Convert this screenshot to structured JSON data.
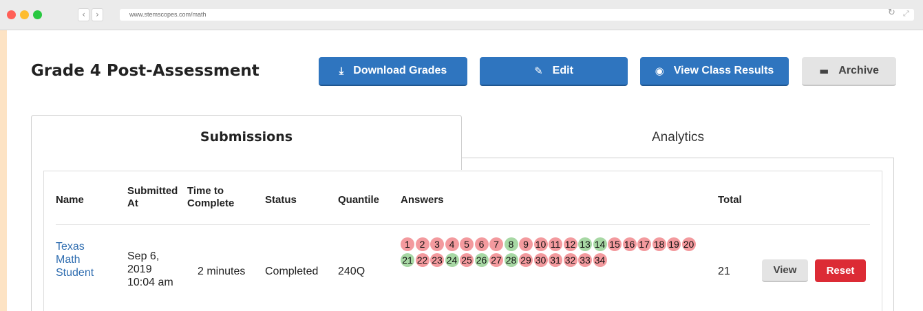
{
  "browser": {
    "url": "www.stemscopes.com/math",
    "back_icon": "‹",
    "forward_icon": "›",
    "reload_icon": "↻",
    "expand_icon": "⤢",
    "dots": [
      "#ff5f57",
      "#febc2e",
      "#28c840"
    ]
  },
  "header": {
    "title": "Grade 4 Post-Assessment",
    "buttons": {
      "download": {
        "label": "Download Grades",
        "icon": "⤓"
      },
      "edit": {
        "label": "Edit",
        "icon": "✎"
      },
      "view_results": {
        "label": "View Class Results",
        "icon": "◉"
      },
      "archive": {
        "label": "Archive",
        "icon": "▬"
      }
    }
  },
  "tabs": [
    {
      "label": "Submissions",
      "active": true
    },
    {
      "label": "Analytics",
      "active": false
    }
  ],
  "table": {
    "headers": {
      "name": "Name",
      "submitted_l1": "Submitted",
      "submitted_l2": "At",
      "time_l1": "Time to",
      "time_l2": "Complete",
      "status": "Status",
      "quantile": "Quantile",
      "answers": "Answers",
      "total": "Total"
    },
    "row": {
      "name_l1": "Texas",
      "name_l2": "Math",
      "name_l3": "Student",
      "submitted_l1": "Sep 6,",
      "submitted_l2": "2019",
      "submitted_l3": "10:04 am",
      "time": "2 minutes",
      "status": "Completed",
      "quantile": "240Q",
      "total": "21",
      "view_label": "View",
      "reset_label": "Reset",
      "answers": [
        {
          "n": "1",
          "correct": false
        },
        {
          "n": "2",
          "correct": false
        },
        {
          "n": "3",
          "correct": false
        },
        {
          "n": "4",
          "correct": false
        },
        {
          "n": "5",
          "correct": false
        },
        {
          "n": "6",
          "correct": false
        },
        {
          "n": "7",
          "correct": false
        },
        {
          "n": "8",
          "correct": true
        },
        {
          "n": "9",
          "correct": false
        },
        {
          "n": "10",
          "correct": false
        },
        {
          "n": "11",
          "correct": false
        },
        {
          "n": "12",
          "correct": false
        },
        {
          "n": "13",
          "correct": true
        },
        {
          "n": "14",
          "correct": true
        },
        {
          "n": "15",
          "correct": false
        },
        {
          "n": "16",
          "correct": false
        },
        {
          "n": "17",
          "correct": false
        },
        {
          "n": "18",
          "correct": false
        },
        {
          "n": "19",
          "correct": false
        },
        {
          "n": "20",
          "correct": false
        },
        {
          "n": "21",
          "correct": true
        },
        {
          "n": "22",
          "correct": false
        },
        {
          "n": "23",
          "correct": false
        },
        {
          "n": "24",
          "correct": true
        },
        {
          "n": "25",
          "correct": false
        },
        {
          "n": "26",
          "correct": true
        },
        {
          "n": "27",
          "correct": false
        },
        {
          "n": "28",
          "correct": true
        },
        {
          "n": "29",
          "correct": false
        },
        {
          "n": "30",
          "correct": false
        },
        {
          "n": "31",
          "correct": false
        },
        {
          "n": "32",
          "correct": false
        },
        {
          "n": "33",
          "correct": false
        },
        {
          "n": "34",
          "correct": false
        }
      ]
    }
  },
  "colors": {
    "primary": "#2f75bf",
    "danger": "#dc2b35",
    "correct": "#a7d8a4",
    "wrong": "#f39a9e",
    "background": "#fde3c4"
  }
}
